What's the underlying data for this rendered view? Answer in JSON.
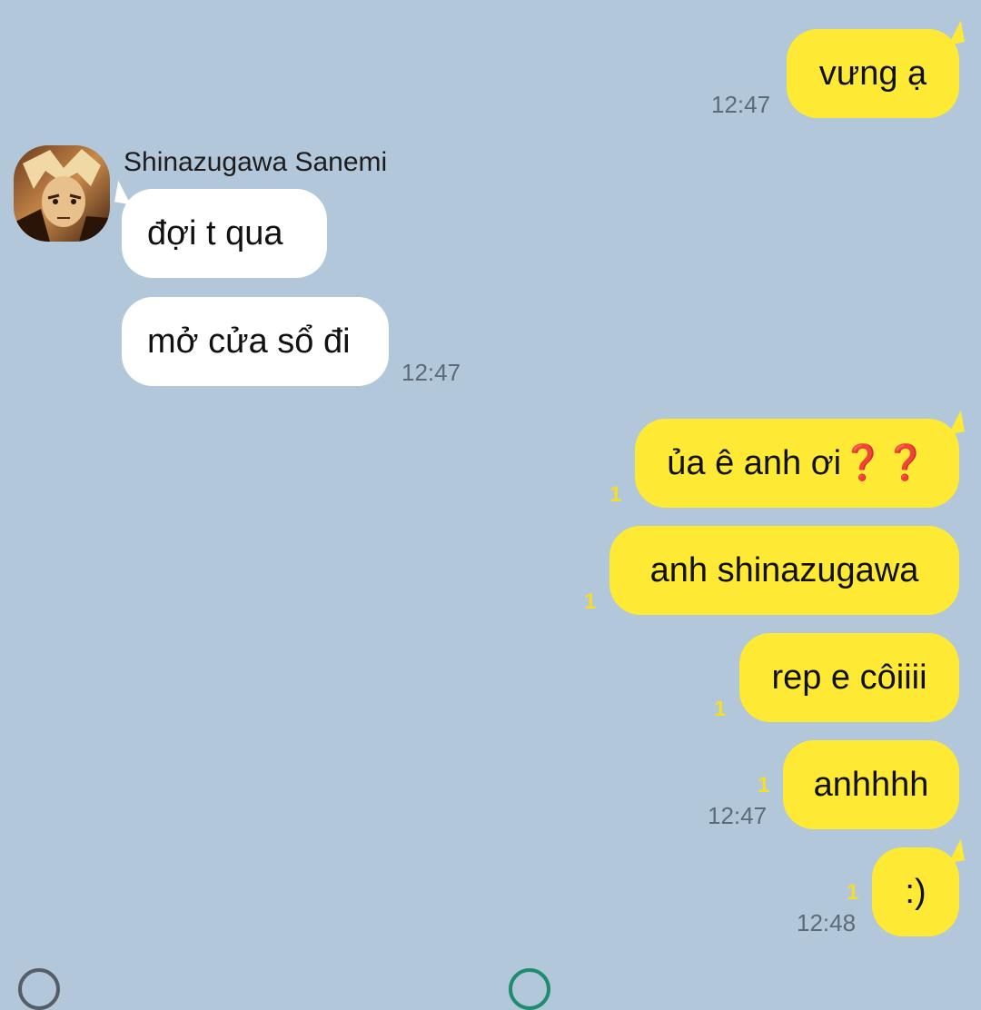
{
  "contact": {
    "name": "Shinazugawa Sanemi",
    "avatar_icon": "anime-character-avatar"
  },
  "messages": [
    {
      "id": "m1",
      "from": "me",
      "text": "vưng ạ",
      "time": "12:47",
      "unread": ""
    },
    {
      "id": "m2",
      "from": "them",
      "text": "đợi t qua",
      "time": ""
    },
    {
      "id": "m3",
      "from": "them",
      "text": "mở cửa sổ đi",
      "time": "12:47"
    },
    {
      "id": "m4",
      "from": "me",
      "text": "ủa ê anh ơi",
      "emoji": "❓❓",
      "time": "",
      "unread": "1"
    },
    {
      "id": "m5",
      "from": "me",
      "text": "anh shinazugawa",
      "time": "",
      "unread": "1"
    },
    {
      "id": "m6",
      "from": "me",
      "text": "rep e côiiii",
      "time": "",
      "unread": "1"
    },
    {
      "id": "m7",
      "from": "me",
      "text": "anhhhh",
      "time": "12:47",
      "unread": "1"
    },
    {
      "id": "m8",
      "from": "me",
      "text": ":)",
      "time": "12:48",
      "unread": "1"
    }
  ],
  "colors": {
    "background": "#b2c7da",
    "my_bubble": "#fee934",
    "their_bubble": "#ffffff",
    "timestamp": "#5d6b78",
    "unread_badge": "#f5dd2b"
  },
  "bottom_bar": {
    "left_icon": "circle-icon",
    "center_icon": "circle-icon"
  }
}
